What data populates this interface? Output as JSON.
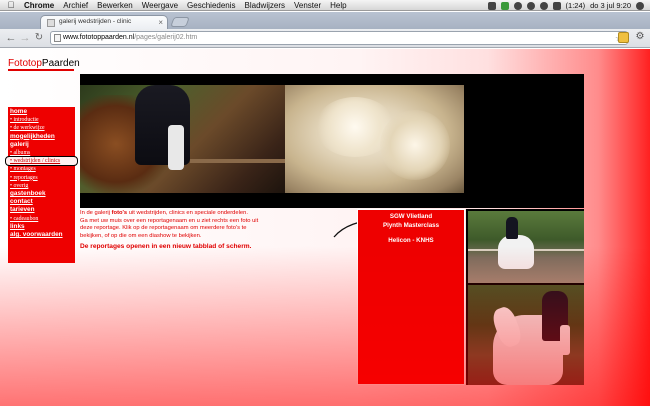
{
  "menubar": {
    "app": "Chrome",
    "items": [
      "Archief",
      "Bewerken",
      "Weergave",
      "Geschiedenis",
      "Bladwijzers",
      "Venster",
      "Help"
    ],
    "battery": "(1:24)",
    "clock": "do 3 jul  9:20"
  },
  "browser": {
    "tab_title": "galerij wedstrijden - clinic",
    "url_host": "www.fototoppaarden.nl",
    "url_path": "/pages/galerij02.htm"
  },
  "site": {
    "logo_part1": "Fototop",
    "logo_part2": "Paarden",
    "colors": {
      "accent": "#ee0000"
    }
  },
  "sidebar": {
    "items": [
      {
        "label": "home",
        "kind": "head"
      },
      {
        "label": "• introductie",
        "kind": "sub"
      },
      {
        "label": "• de werkwijze",
        "kind": "sub"
      },
      {
        "label": "mogelijkheden",
        "kind": "head"
      },
      {
        "label": "galerij",
        "kind": "head-plain"
      },
      {
        "label": "• albums",
        "kind": "sub"
      },
      {
        "label": "• wedstrijden / clinics",
        "kind": "current"
      },
      {
        "label": "• montages",
        "kind": "sub"
      },
      {
        "label": "• reportages",
        "kind": "sub"
      },
      {
        "label": "• overig",
        "kind": "sub"
      },
      {
        "label": "gastenboek",
        "kind": "head"
      },
      {
        "label": "contact",
        "kind": "head"
      },
      {
        "label": "tarieven",
        "kind": "head"
      },
      {
        "label": "• cadeaubon",
        "kind": "sub"
      },
      {
        "label": "links",
        "kind": "head"
      },
      {
        "label": "alg. voorwaarden",
        "kind": "head"
      }
    ]
  },
  "intro": {
    "line1_a": "In de galerij ",
    "line1_b": "foto's",
    "line1_c": " uit wedstrijden, clinics en speciale onderdelen.",
    "line2": "Ga met uw muis over een reportagenaam en u ziet rechts een foto uit",
    "line3": "deze reportage. Klik op de reportagenaam om meerdere foto's te",
    "line4": "bekijken, of op die om een diashow te bekijken.",
    "bold": "De reportages openen in een nieuw tabblad of scherm."
  },
  "reports": {
    "items": [
      "SGW Vlietland",
      "Plynth Masterclass",
      "Helicon - KNHS"
    ]
  }
}
